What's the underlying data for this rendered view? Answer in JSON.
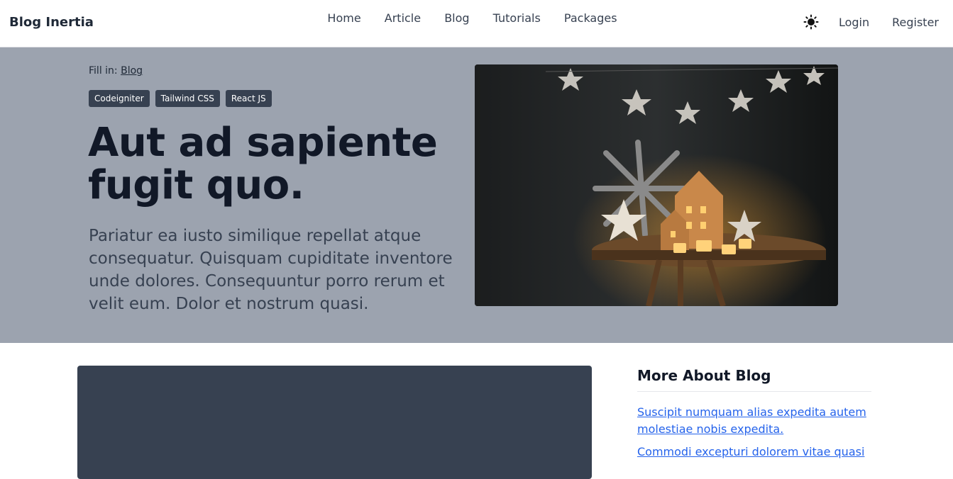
{
  "brand": "Blog Inertia",
  "nav": {
    "links": [
      "Home",
      "Article",
      "Blog",
      "Tutorials",
      "Packages"
    ],
    "theme_icon": "sun-icon",
    "login": "Login",
    "register": "Register"
  },
  "hero": {
    "fill_in_label": "Fill in:",
    "fill_in_link": "Blog",
    "tags": [
      "Codeigniter",
      "Tailwind CSS",
      "React JS"
    ],
    "title": "Aut ad sapiente fugit quo.",
    "description": "Pariatur ea iusto similique repellat atque consequatur. Quisquam cupiditate inventore unde dolores. Consequuntur porro rerum et velit eum. Dolor et nostrum quasi."
  },
  "sidebar": {
    "title": "More About Blog",
    "links": [
      "Suscipit numquam alias expedita autem molestiae nobis expedita.",
      "Commodi excepturi dolorem vitae quasi"
    ]
  },
  "colors": {
    "hero_bg": "#9ca3af",
    "tag_bg": "#374151",
    "video_bg": "#374151",
    "link": "#2563eb"
  }
}
